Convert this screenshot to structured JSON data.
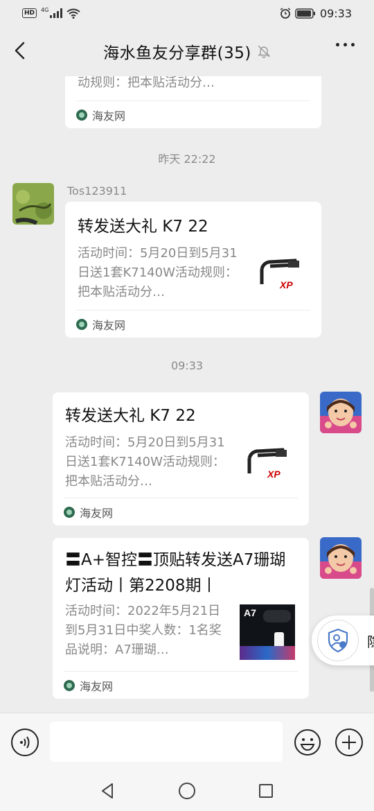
{
  "status_bar": {
    "hd": "HD",
    "network": "4G",
    "time": "09:33"
  },
  "header": {
    "title": "海水鱼友分享群(35)"
  },
  "messages": [
    {
      "desc_partial": "动规则：把本贴活动分…",
      "source": "海友网"
    },
    {
      "timestamp": "昨天 22:22"
    },
    {
      "sender": "Tos123911",
      "title": "转发送大礼 K7 22",
      "desc": "活动时间：5月20日到5月31日送1套K7140W活动规则：把本贴活动分…",
      "source": "海友网"
    },
    {
      "timestamp": "09:33"
    },
    {
      "title": "转发送大礼 K7 22",
      "desc": "活动时间：5月20日到5月31日送1套K7140W活动规则：把本贴活动分…",
      "source": "海友网"
    },
    {
      "title": "〓A+智控〓顶贴转发送A7珊瑚灯活动丨第2208期丨",
      "desc": "活动时间：2022年5月21日到5月31日中奖人数：1名奖品说明：A7珊瑚…",
      "source": "海友网",
      "thumb_label": "A7"
    }
  ],
  "floating": {
    "label": "隐"
  },
  "input": {
    "placeholder": ""
  },
  "icons": {
    "back": "chevron-left-icon",
    "mute": "bell-off-icon",
    "more": "more-horizontal-icon",
    "voice": "voice-icon",
    "emoji": "emoji-icon",
    "plus": "plus-circle-icon"
  },
  "colors": {
    "background": "#ededed",
    "card": "#ffffff",
    "source_icon": "#2d6a4f"
  }
}
